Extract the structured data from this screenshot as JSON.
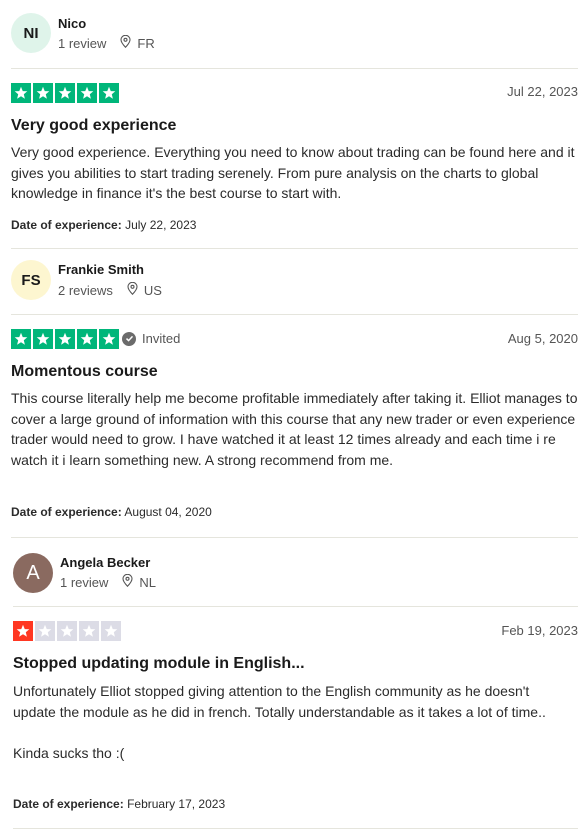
{
  "colors": {
    "star_green": "#00b67a",
    "star_red": "#ff3722",
    "star_empty": "#dcdce6",
    "avatar_1": "#dff4ea",
    "avatar_2": "#fdf6d0",
    "avatar_3": "#8a6a60"
  },
  "reviews": [
    {
      "avatar_initials": "NI",
      "name": "Nico",
      "review_count": "1 review",
      "country": "FR",
      "rating": 5,
      "invited": "",
      "date": "Jul 22, 2023",
      "title": "Very good experience",
      "body": "Very good experience. Everything you need to know about trading can be found here and it gives you abilities to start trading serenely. From pure analysis on the charts to global knowledge in finance it's the best course to start with.",
      "experience_label": "Date of experience:",
      "experience_date": "July 22, 2023"
    },
    {
      "avatar_initials": "FS",
      "name": "Frankie Smith",
      "review_count": "2 reviews",
      "country": "US",
      "rating": 5,
      "invited": "Invited",
      "date": "Aug 5, 2020",
      "title": "Momentous course",
      "body": "This course literally help me become profitable immediately after taking it. Elliot manages to cover a large ground of information with this course that any new trader or even experience trader would need to grow. I have watched it at least 12 times already and each time i re watch it i learn something new. A strong recommend from me.",
      "experience_label": "Date of experience:",
      "experience_date": "August 04, 2020"
    },
    {
      "avatar_initials": "A",
      "name": "Angela Becker",
      "review_count": "1 review",
      "country": "NL",
      "rating": 1,
      "invited": "",
      "date": "Feb 19, 2023",
      "title": "Stopped updating module in English...",
      "body": "Unfortunately Elliot stopped giving attention to the English community as he doesn't update the module as he did in french. Totally understandable as it takes a lot of time..\n\nKinda sucks tho :(",
      "experience_label": "Date of experience:",
      "experience_date": "February 17, 2023"
    }
  ]
}
